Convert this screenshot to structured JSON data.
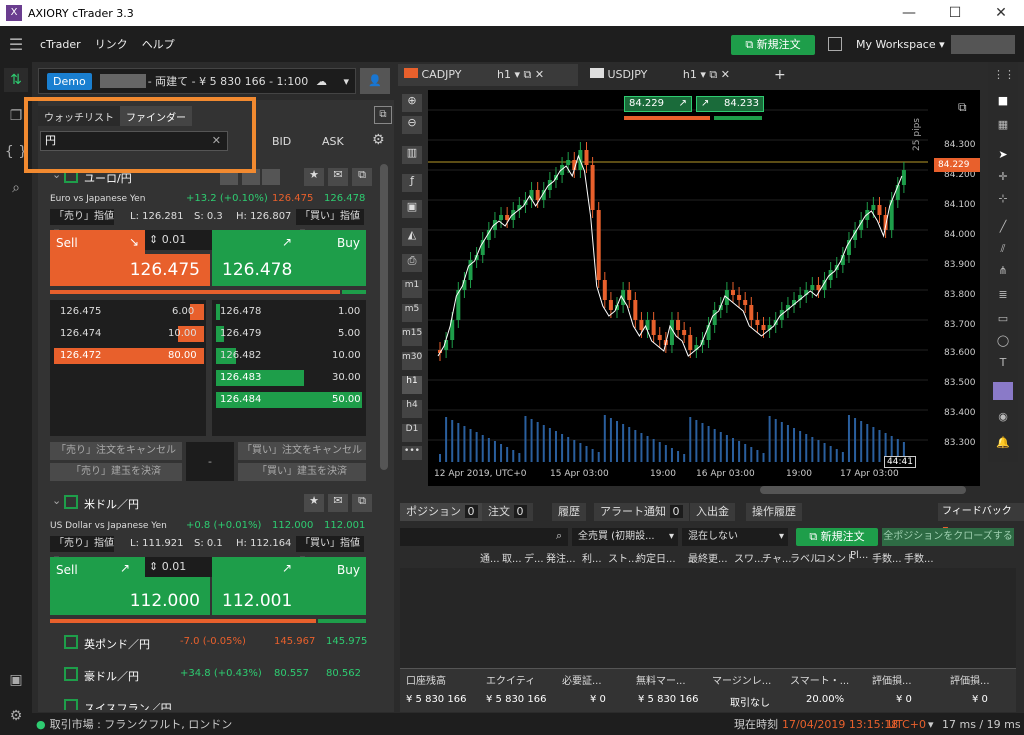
{
  "window": {
    "title": "AXIORY cTrader 3.3",
    "minimize": "—",
    "maximize": "☐",
    "close": "✕"
  },
  "menu": {
    "items": [
      "cTrader",
      "リンク",
      "ヘルプ"
    ],
    "new_order": "新規注文",
    "workspace": "My Workspace"
  },
  "account": {
    "badge": "Demo",
    "text": "- 両建て - ¥ 5 830 166 - 1:100"
  },
  "watch_tabs": {
    "watchlist": "ウォッチリスト",
    "finder": "ファインダー",
    "search_value": "円",
    "bid": "BID",
    "ask": "ASK"
  },
  "sym1": {
    "name": "ユーロ/円",
    "desc": "Euro vs Japanese Yen",
    "change": "+13.2 (+0.10%)",
    "bid": "126.475",
    "ask": "126.478",
    "sell_type": "「売り」指値",
    "low": "L: 126.281",
    "spread": "S: 0.3",
    "high": "H: 126.807",
    "buy_type": "「買い」指値",
    "sell_label": "Sell",
    "buy_label": "Buy",
    "volume": "0.01",
    "sell_price": "126.475",
    "buy_price": "126.478",
    "depth_sell": [
      {
        "price": "126.475",
        "vol": "6.00"
      },
      {
        "price": "126.474",
        "vol": "10.00"
      },
      {
        "price": "126.472",
        "vol": "80.00"
      }
    ],
    "depth_buy": [
      {
        "price": "126.478",
        "vol": "1.00"
      },
      {
        "price": "126.479",
        "vol": "5.00"
      },
      {
        "price": "126.482",
        "vol": "10.00"
      },
      {
        "price": "126.483",
        "vol": "30.00"
      },
      {
        "price": "126.484",
        "vol": "50.00"
      }
    ],
    "cancel_sell": "「売り」注文をキャンセル",
    "close_sell": "「売り」建玉を決済",
    "dash": "-",
    "cancel_buy": "「買い」注文をキャンセル",
    "close_buy": "「買い」建玉を決済"
  },
  "sym2": {
    "name": "米ドル／円",
    "desc": "US Dollar vs Japanese Yen",
    "change": "+0.8 (+0.01%)",
    "bid": "112.000",
    "ask": "112.001",
    "sell_type": "「売り」指値",
    "low": "L: 111.921",
    "spread": "S: 0.1",
    "high": "H: 112.164",
    "buy_type": "「買い」指値",
    "sell_label": "Sell",
    "buy_label": "Buy",
    "volume": "0.01",
    "sell_price": "112.000",
    "buy_price": "112.001"
  },
  "sym3": {
    "name": "英ポンド／円",
    "change": "-7.0 (-0.05%)",
    "bid": "145.967",
    "ask": "145.975"
  },
  "sym4": {
    "name": "豪ドル／円",
    "change": "+34.8 (+0.43%)",
    "bid": "80.557",
    "ask": "80.562"
  },
  "sym5": {
    "name": "スイスフラン／円"
  },
  "chart_tabs": [
    {
      "symbol": "CADJPY",
      "tf": "h1"
    },
    {
      "symbol": "USDJPY",
      "tf": "h1"
    }
  ],
  "chart": {
    "sell_quote": "84.229",
    "buy_quote": "84.233",
    "pips": "25 pips",
    "current": "84.229",
    "yticks": [
      "84.300",
      "84.200",
      "84.100",
      "84.000",
      "83.900",
      "83.800",
      "83.700",
      "83.600",
      "83.500",
      "83.400",
      "83.300"
    ],
    "xticks": [
      "12 Apr 2019, UTC+0",
      "15 Apr 03:00",
      "19:00",
      "16 Apr 03:00",
      "19:00",
      "17 Apr 03:00"
    ],
    "countdown": "44:41",
    "tf_buttons": [
      "m1",
      "m5",
      "m15",
      "m30",
      "h1",
      "h4",
      "D1"
    ]
  },
  "positions": {
    "tabs": [
      {
        "label": "ポジション",
        "count": "0"
      },
      {
        "label": "注文",
        "count": "0"
      },
      {
        "label": "履歴",
        "count": ""
      },
      {
        "label": "アラート通知",
        "count": "0"
      },
      {
        "label": "入出金",
        "count": ""
      },
      {
        "label": "操作履歴",
        "count": ""
      }
    ],
    "feedback": "フィードバック",
    "filter1": "全売買 (初期設...",
    "filter2": "混在しない",
    "new_order": "新規注文",
    "close_all": "全ポジションをクローズする",
    "columns": [
      "通...",
      "取...",
      "デ...",
      "発注...",
      "利...",
      "スト...",
      "約定日...",
      "最終更...",
      "スワ...",
      "チャ...",
      "ラベル",
      "コメント",
      "Pl...",
      "手数...",
      "手数..."
    ]
  },
  "stats": [
    {
      "label": "口座残高",
      "value": "¥ 5 830 166"
    },
    {
      "label": "エクイティ",
      "value": "¥ 5 830 166"
    },
    {
      "label": "必要証...",
      "value": "¥ 0"
    },
    {
      "label": "無料マー...",
      "value": "¥ 5 830 166"
    },
    {
      "label": "マージンレ...",
      "value": "取引なし"
    },
    {
      "label": "スマート・...",
      "value": "20.00%"
    },
    {
      "label": "評価損...",
      "value": "¥ 0"
    },
    {
      "label": "評価損...",
      "value": "¥ 0"
    }
  ],
  "footer": {
    "market": "取引市場 : フランクフルト, ロンドン",
    "time_label": "現在時刻",
    "time": "17/04/2019 13:15:18",
    "tz": "UTC+0",
    "latency": "17 ms / 19 ms"
  },
  "colors": {
    "sell": "#e8602c",
    "buy": "#1e9e4a",
    "accent": "#f28a30"
  }
}
